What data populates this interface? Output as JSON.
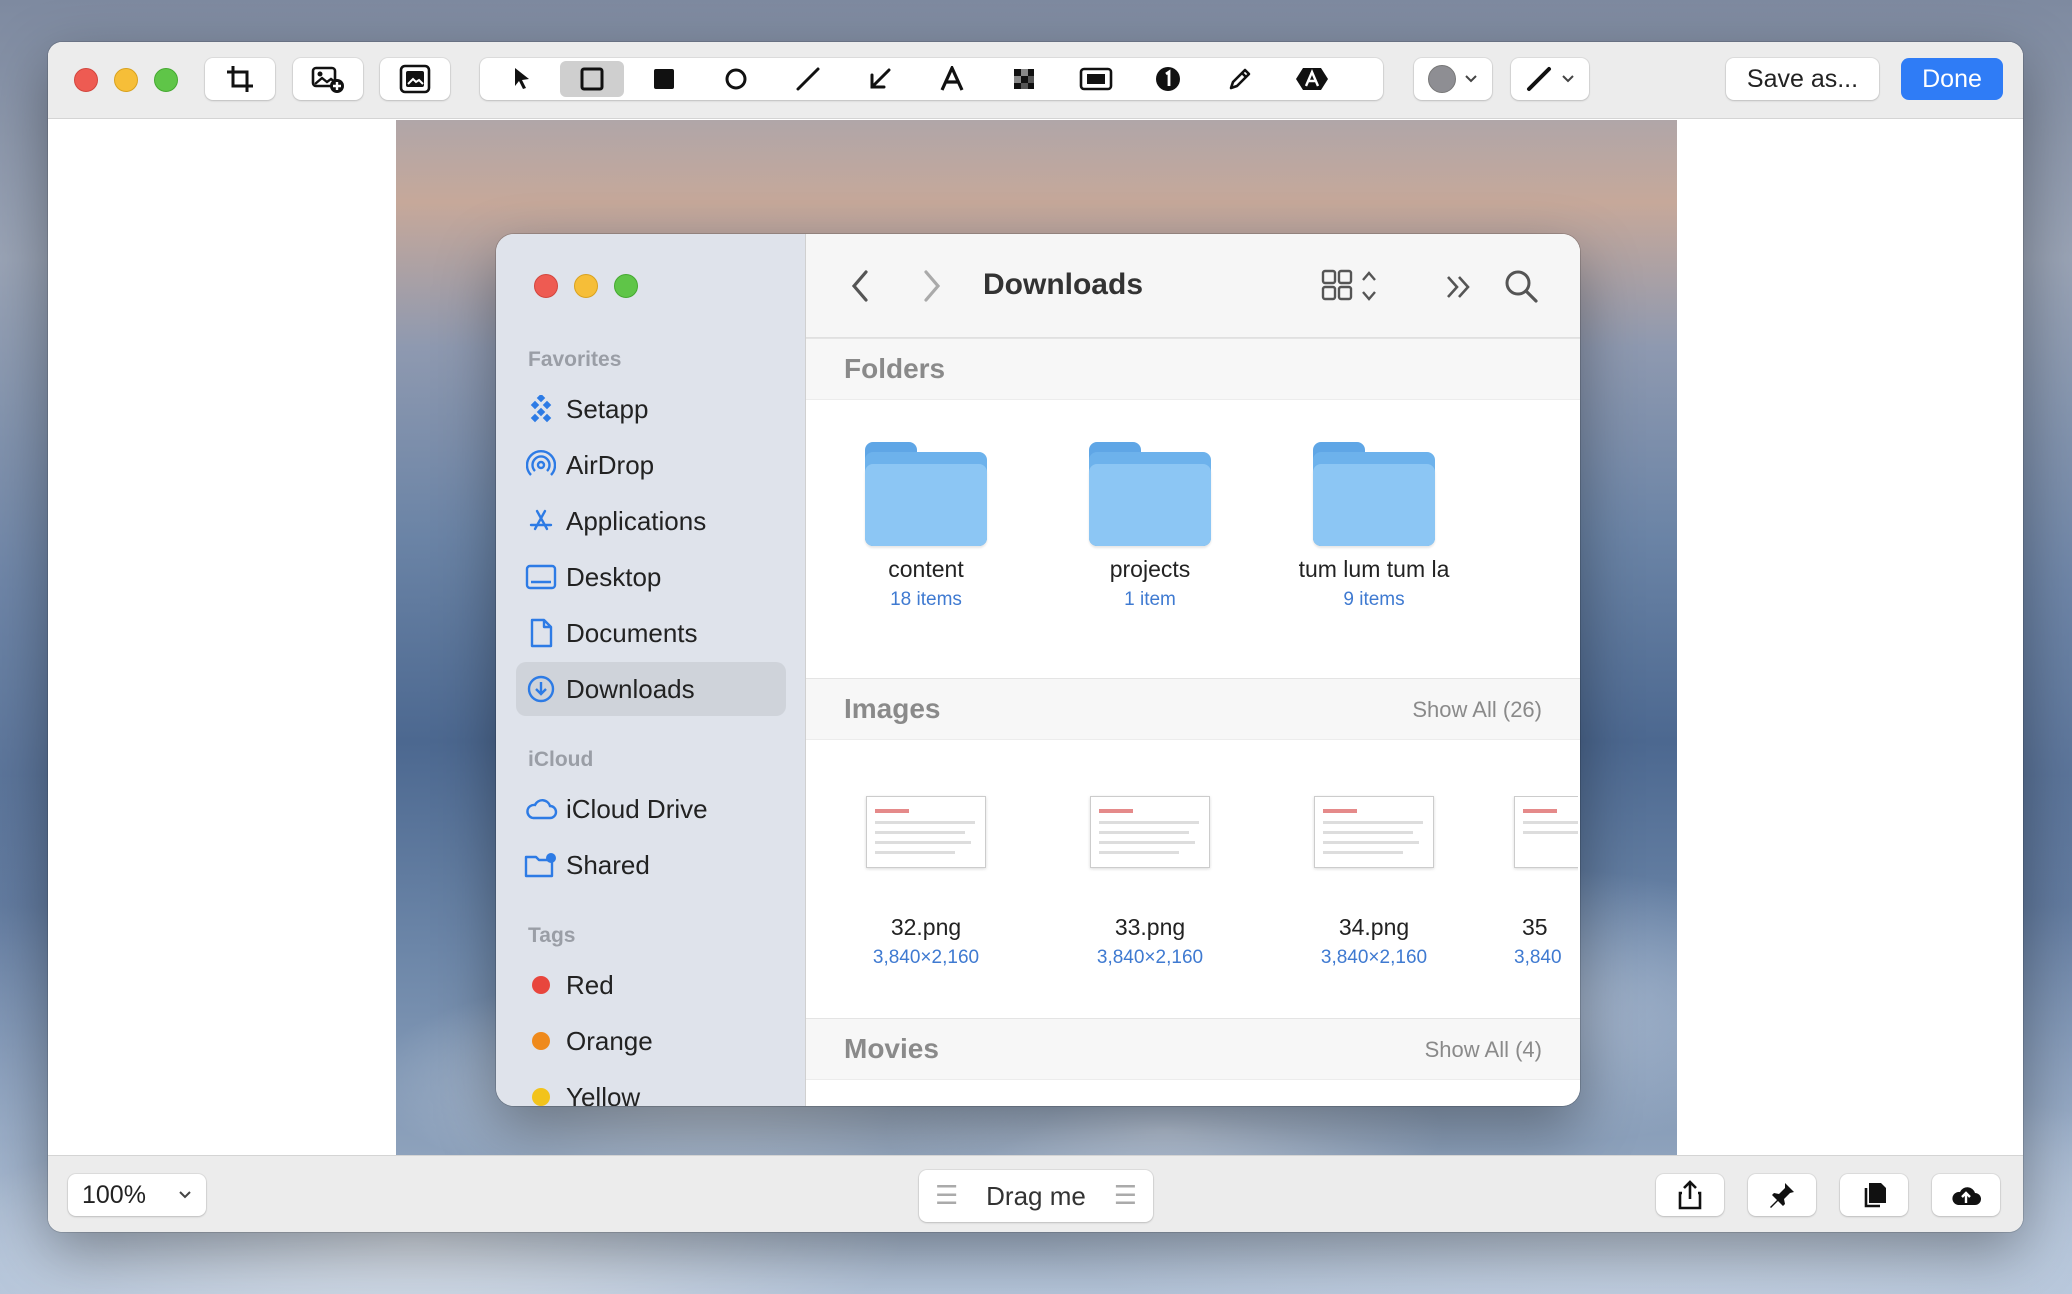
{
  "toolbar": {
    "save_label": "Save as...",
    "done_label": "Done",
    "tools": [
      "crop-icon",
      "add-image-icon",
      "background-icon",
      "pointer-icon",
      "rectangle-icon",
      "filled-rectangle-icon",
      "circle-icon",
      "line-icon",
      "arrow-icon",
      "text-icon",
      "pixelate-icon",
      "highlight-icon",
      "counter-icon",
      "pencil-icon",
      "blur-text-icon"
    ],
    "active_tool": "rectangle-icon",
    "color_swatch": "#8e8e93"
  },
  "finder": {
    "title": "Downloads",
    "sidebar": {
      "favorites_header": "Favorites",
      "favorites": [
        {
          "label": "Setapp",
          "icon": "setapp-icon"
        },
        {
          "label": "AirDrop",
          "icon": "airdrop-icon"
        },
        {
          "label": "Applications",
          "icon": "applications-icon"
        },
        {
          "label": "Desktop",
          "icon": "desktop-icon"
        },
        {
          "label": "Documents",
          "icon": "document-icon"
        },
        {
          "label": "Downloads",
          "icon": "download-icon",
          "selected": true
        }
      ],
      "icloud_header": "iCloud",
      "icloud": [
        {
          "label": "iCloud Drive",
          "icon": "cloud-icon"
        },
        {
          "label": "Shared",
          "icon": "shared-folder-icon"
        }
      ],
      "tags_header": "Tags",
      "tags": [
        {
          "label": "Red",
          "color": "#e8463d"
        },
        {
          "label": "Orange",
          "color": "#ef8a1c"
        },
        {
          "label": "Yellow",
          "color": "#f2c31b"
        }
      ]
    },
    "folders_section": {
      "title": "Folders",
      "items": [
        {
          "name": "content",
          "sub": "18 items"
        },
        {
          "name": "projects",
          "sub": "1 item"
        },
        {
          "name": "tum lum tum la",
          "sub": "9 items"
        }
      ]
    },
    "images_section": {
      "title": "Images",
      "show_all": "Show All (26)",
      "items": [
        {
          "name": "32.png",
          "sub": "3,840×2,160"
        },
        {
          "name": "33.png",
          "sub": "3,840×2,160"
        },
        {
          "name": "34.png",
          "sub": "3,840×2,160"
        },
        {
          "name": "35",
          "sub": "3,840"
        }
      ]
    },
    "movies_section": {
      "title": "Movies",
      "show_all": "Show All (4)"
    }
  },
  "bottombar": {
    "zoom": "100%",
    "drag_label": "Drag me",
    "actions": [
      "share-icon",
      "pin-icon",
      "copy-icon",
      "cloud-upload-icon"
    ]
  }
}
